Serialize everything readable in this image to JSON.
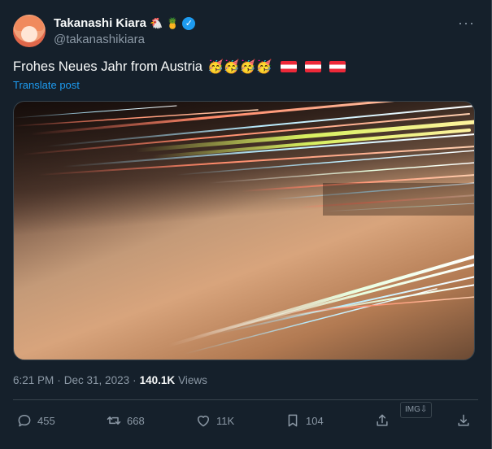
{
  "author": {
    "display_name": "Takanashi Kiara",
    "name_emoji_1": "🐔",
    "name_emoji_2": "🍍",
    "verified_mark": "✓",
    "handle": "@takanashikiara",
    "avatar_icon": "avatar-icon"
  },
  "more_label": "···",
  "tweet": {
    "text": "Frohes Neues Jahr from Austria",
    "emojis": "🥳🥳🥳🥳",
    "flags": [
      "austria-flag",
      "austria-flag",
      "austria-flag"
    ],
    "translate_label": "Translate post"
  },
  "media": {
    "description_icon": "photo-icon"
  },
  "meta": {
    "time": "6:21 PM",
    "separator": "·",
    "date": "Dec 31, 2023",
    "views_separator": "·",
    "views_count": "140.1K",
    "views_label": "Views"
  },
  "actions": {
    "replies": "455",
    "reposts": "668",
    "likes": "11K",
    "bookmarks": "104"
  },
  "img_badge": "IMG⇩",
  "colors": {
    "background": "#15202b",
    "accent": "#1d9bf0",
    "secondary_text": "#8b98a5",
    "border": "#38444d"
  }
}
